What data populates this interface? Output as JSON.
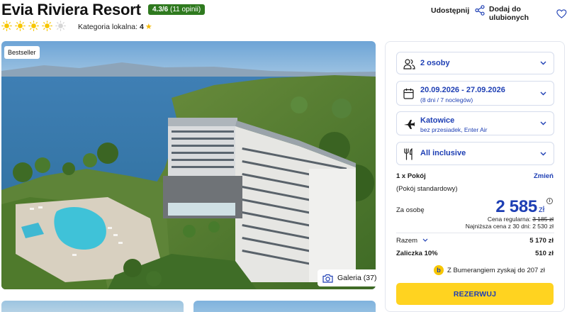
{
  "header": {
    "title": "Evia Riviera Resort",
    "rating_score": "4.3/6",
    "rating_count": "(11 opinii)",
    "suns_total": 5,
    "suns_filled": 4,
    "category_label": "Kategoria lokalna:",
    "category_value": "4",
    "share_label": "Udostępnij",
    "favorite_label": "Dodaj do ulubionych"
  },
  "gallery": {
    "badge": "Bestseller",
    "button_label": "Galeria (37)"
  },
  "booking": {
    "persons": "2 osoby",
    "dates": "20.09.2026 - 27.09.2026",
    "dates_sub": "(8 dni / 7 noclegów)",
    "departure": "Katowice",
    "departure_sub": "bez przesiadek, Enter Air",
    "board": "All inclusive",
    "room_count": "1 x Pokój",
    "room_change": "Zmień",
    "room_type": "(Pokój standardowy)",
    "per_person_label": "Za osobę",
    "price": "2 585",
    "currency": "zł",
    "regular_label": "Cena regularna:",
    "regular_price": "3 185 zł",
    "lowest_label": "Najniższa cena z 30 dni:",
    "lowest_price": "2 530 zł",
    "total_label": "Razem",
    "total_value": "5 170 zł",
    "deposit_label": "Zaliczka 10%",
    "deposit_value": "510 zł",
    "bumerang_text": "Z Bumerangiem zyskaj do 207 zł",
    "reserve_label": "REZERWUJ"
  },
  "colors": {
    "accent_blue": "#1e3fb4",
    "rating_green": "#2f7a1f",
    "button_yellow": "#ffd320",
    "sun_yellow": "#f7c600"
  }
}
